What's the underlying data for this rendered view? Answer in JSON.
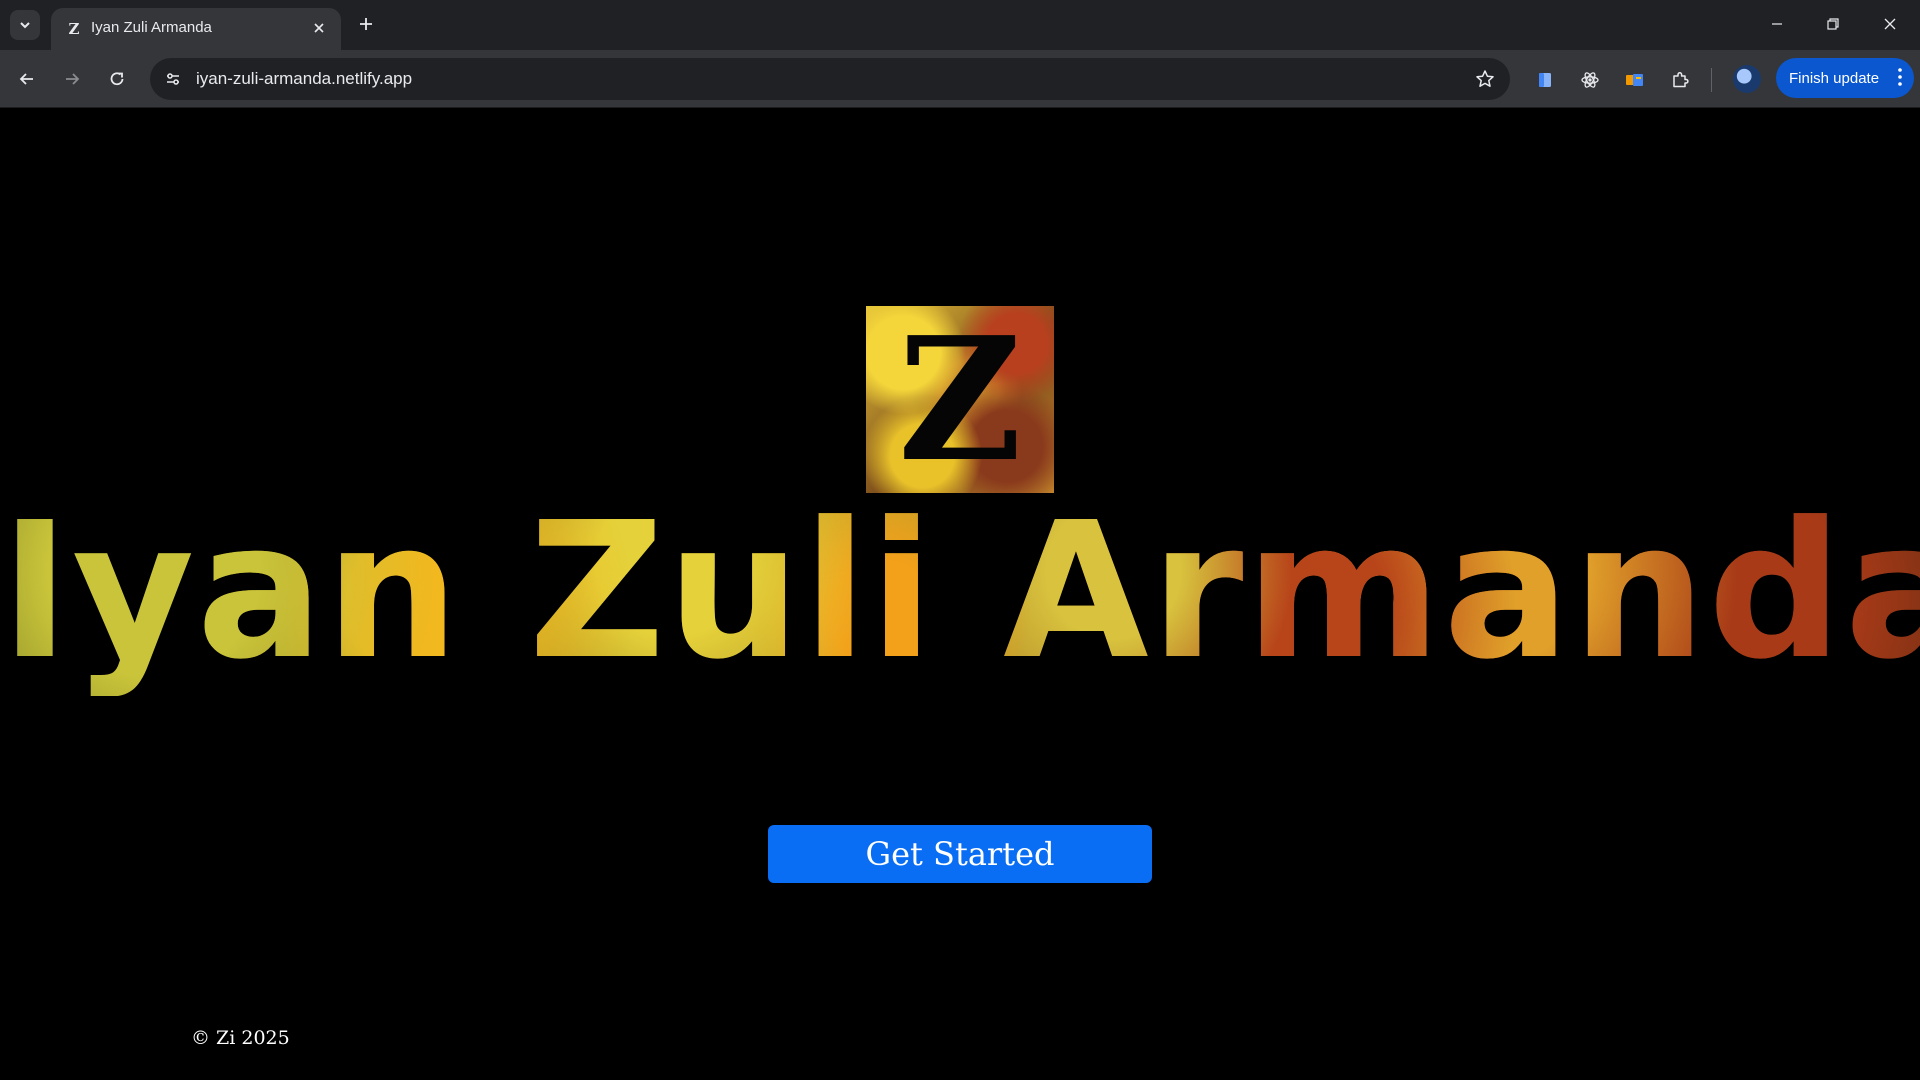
{
  "browser": {
    "tab": {
      "title": "Iyan Zuli Armanda",
      "favicon_letter": "Z"
    },
    "url": "iyan-zuli-armanda.netlify.app",
    "finish_update_label": "Finish update"
  },
  "page": {
    "logo_letter": "Z",
    "hero_title": "Iyan Zuli Armanda",
    "cta_label": "Get Started",
    "footer_text": "© Zi 2025"
  },
  "colors": {
    "page_background": "#000000",
    "cta_background": "#0a6ef5",
    "chrome_background": "#202124",
    "toolbar_background": "#35363a",
    "update_button": "#0b57d0"
  }
}
